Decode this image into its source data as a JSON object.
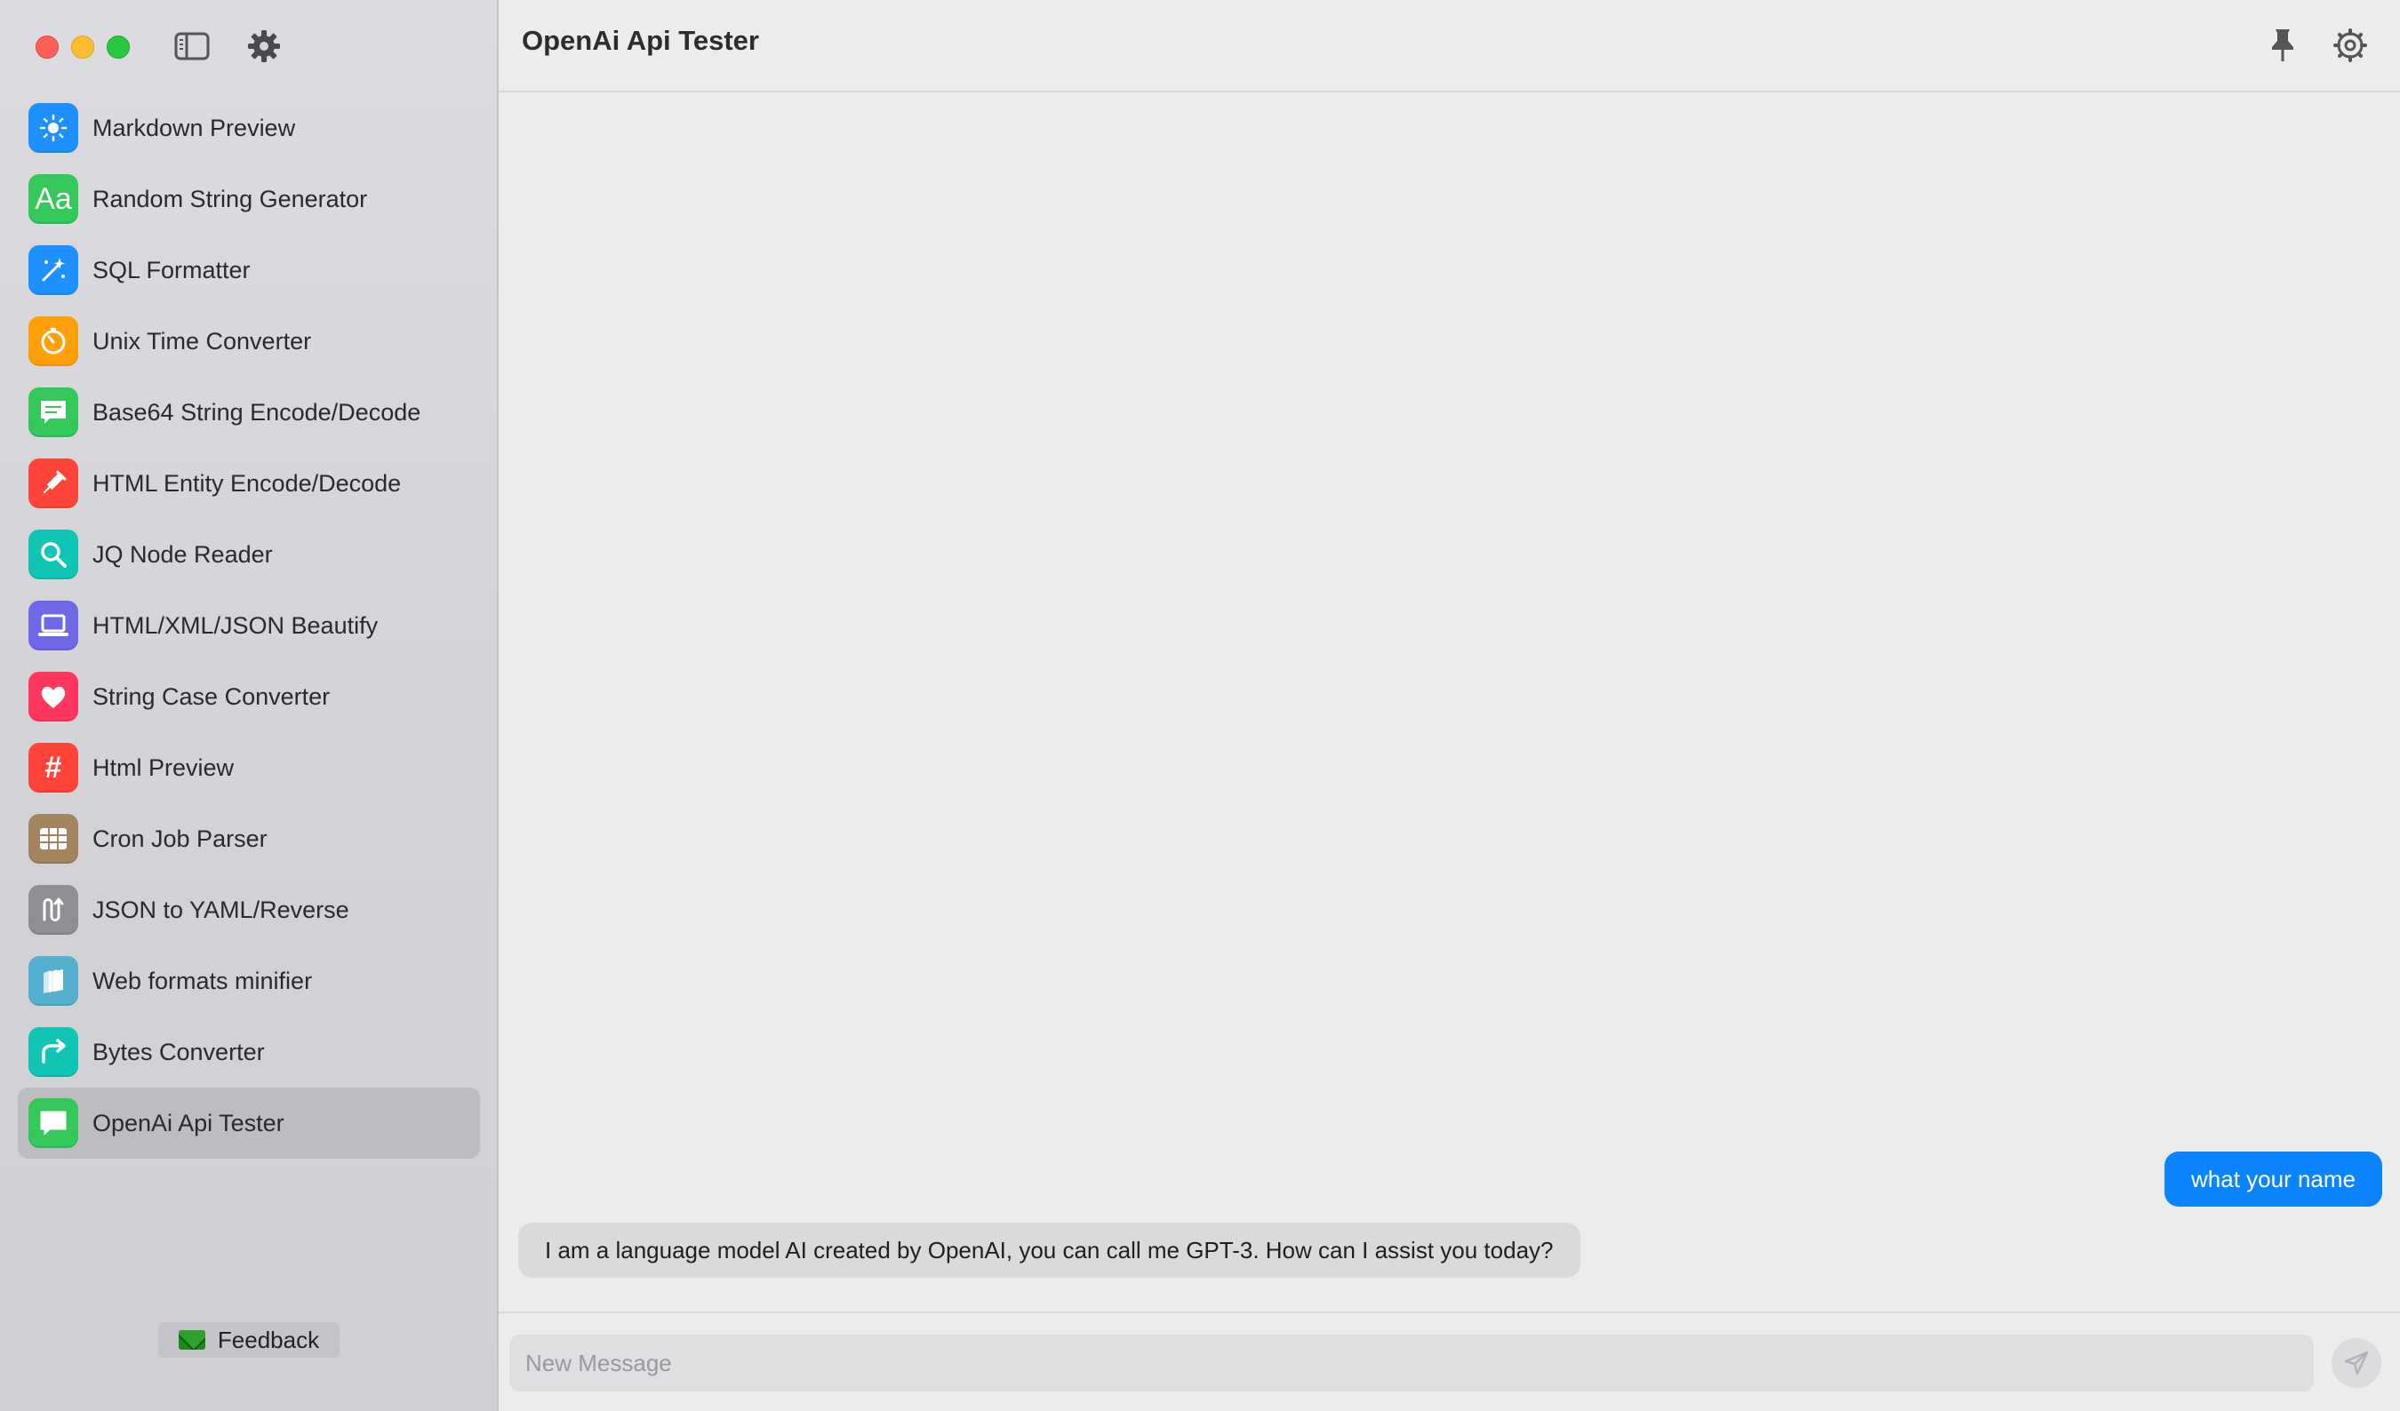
{
  "window": {
    "title": "OpenAi Api Tester"
  },
  "toolbar": {
    "sidebar_toggle_icon": "sidebar-left-icon",
    "settings_icon": "gear-icon"
  },
  "sidebar": {
    "items": [
      {
        "label": "Markdown Preview",
        "icon": "sun-icon",
        "glyph": "",
        "color": "#1e90ff",
        "active": false
      },
      {
        "label": "Random String Generator",
        "icon": "text-aa-icon",
        "glyph": "Aa",
        "color": "#34c759",
        "active": false
      },
      {
        "label": "SQL Formatter",
        "icon": "magic-wand-icon",
        "glyph": "",
        "color": "#1e90ff",
        "active": false
      },
      {
        "label": "Unix Time Converter",
        "icon": "timer-icon",
        "glyph": "",
        "color": "#ff9f0a",
        "active": false
      },
      {
        "label": "Base64 String Encode/Decode",
        "icon": "message-text-icon",
        "glyph": "",
        "color": "#34c759",
        "active": false
      },
      {
        "label": "HTML Entity Encode/Decode",
        "icon": "syringe-icon",
        "glyph": "",
        "color": "#ff453a",
        "active": false
      },
      {
        "label": "JQ Node Reader",
        "icon": "magnifier-icon",
        "glyph": "",
        "color": "#10c4b6",
        "active": false
      },
      {
        "label": "HTML/XML/JSON Beautify",
        "icon": "laptop-icon",
        "glyph": "",
        "color": "#6e68e8",
        "active": false
      },
      {
        "label": "String Case Converter",
        "icon": "heart-icon",
        "glyph": "",
        "color": "#ff375f",
        "active": false
      },
      {
        "label": "Html Preview",
        "icon": "hash-icon",
        "glyph": "#",
        "color": "#ff453a",
        "active": false
      },
      {
        "label": "Cron Job Parser",
        "icon": "grid-table-icon",
        "glyph": "",
        "color": "#a2845e",
        "active": false
      },
      {
        "label": "JSON to YAML/Reverse",
        "icon": "swap-path-icon",
        "glyph": "",
        "color": "#8e8e93",
        "active": false
      },
      {
        "label": "Web formats minifier",
        "icon": "books-icon",
        "glyph": "",
        "color": "#55b0cf",
        "active": false
      },
      {
        "label": "Bytes Converter",
        "icon": "arrow-turn-icon",
        "glyph": "",
        "color": "#10c4b6",
        "active": false
      },
      {
        "label": "OpenAi Api Tester",
        "icon": "chat-bubble-icon",
        "glyph": "",
        "color": "#34c759",
        "active": true
      }
    ],
    "feedback_label": "Feedback",
    "feedback_icon": "envelope-icon"
  },
  "header": {
    "title": "OpenAi Api Tester",
    "pin_icon": "pin-icon",
    "settings_icon": "gear-outline-icon"
  },
  "chat": {
    "messages": [
      {
        "role": "user",
        "text": "what your name"
      },
      {
        "role": "assistant",
        "text": "I am a language model AI created by OpenAI, you can call me GPT-3. How can I assist you today?"
      }
    ]
  },
  "composer": {
    "placeholder": "New Message",
    "value": "",
    "send_icon": "paper-plane-icon"
  },
  "colors": {
    "accent": "#0a84ff",
    "sidebar_active": "#bcbcc1",
    "assistant_bubble": "#dadadc"
  }
}
